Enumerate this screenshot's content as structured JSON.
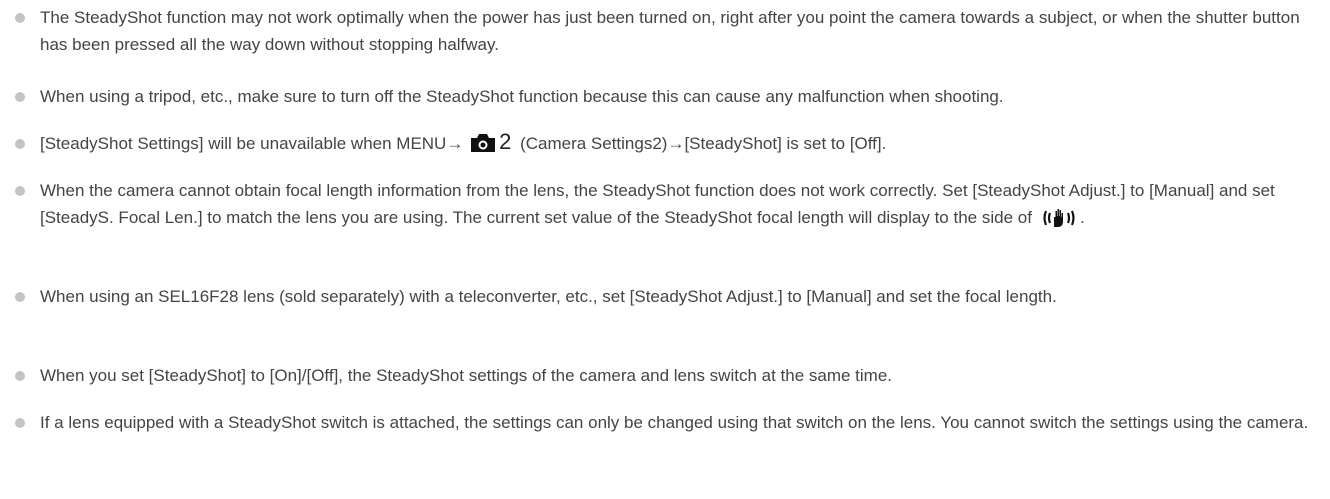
{
  "notes": [
    {
      "text": "The SteadyShot function may not work optimally when the power has just been turned on, right after you point the camera towards a subject, or when the shutter button has been pressed all the way down without stopping halfway."
    },
    {
      "text": "When using a tripod, etc., make sure to turn off the SteadyShot function because this can cause any malfunction when shooting."
    },
    {
      "text_before": "[SteadyShot Settings] will be unavailable when MENU→",
      "icon": "camera-settings-icon",
      "icon_digit": "2",
      "text_after": "(Camera Settings2)→[SteadyShot] is set to [Off]."
    },
    {
      "text_before": "When the camera cannot obtain focal length information from the lens, the SteadyShot function does not work correctly. Set [SteadyShot Adjust.] to [Manual] and set [SteadyS. Focal Len.] to match the lens you are using. The current set value of the SteadyShot focal length will display to the side of",
      "icon": "steadyshot-icon",
      "text_after": "."
    },
    {
      "text": "When using an SEL16F28 lens (sold separately) with a teleconverter, etc., set [SteadyShot Adjust.] to [Manual] and set the focal length."
    },
    {
      "text": "When you set [SteadyShot] to [On]/[Off], the SteadyShot settings of the camera and lens switch at the same time."
    },
    {
      "text": "If a lens equipped with a SteadyShot switch is attached, the settings can only be changed using that switch on the lens. You cannot switch the settings using the camera."
    }
  ],
  "colors": {
    "text": "#444444",
    "bullet": "#c4c4c4"
  }
}
